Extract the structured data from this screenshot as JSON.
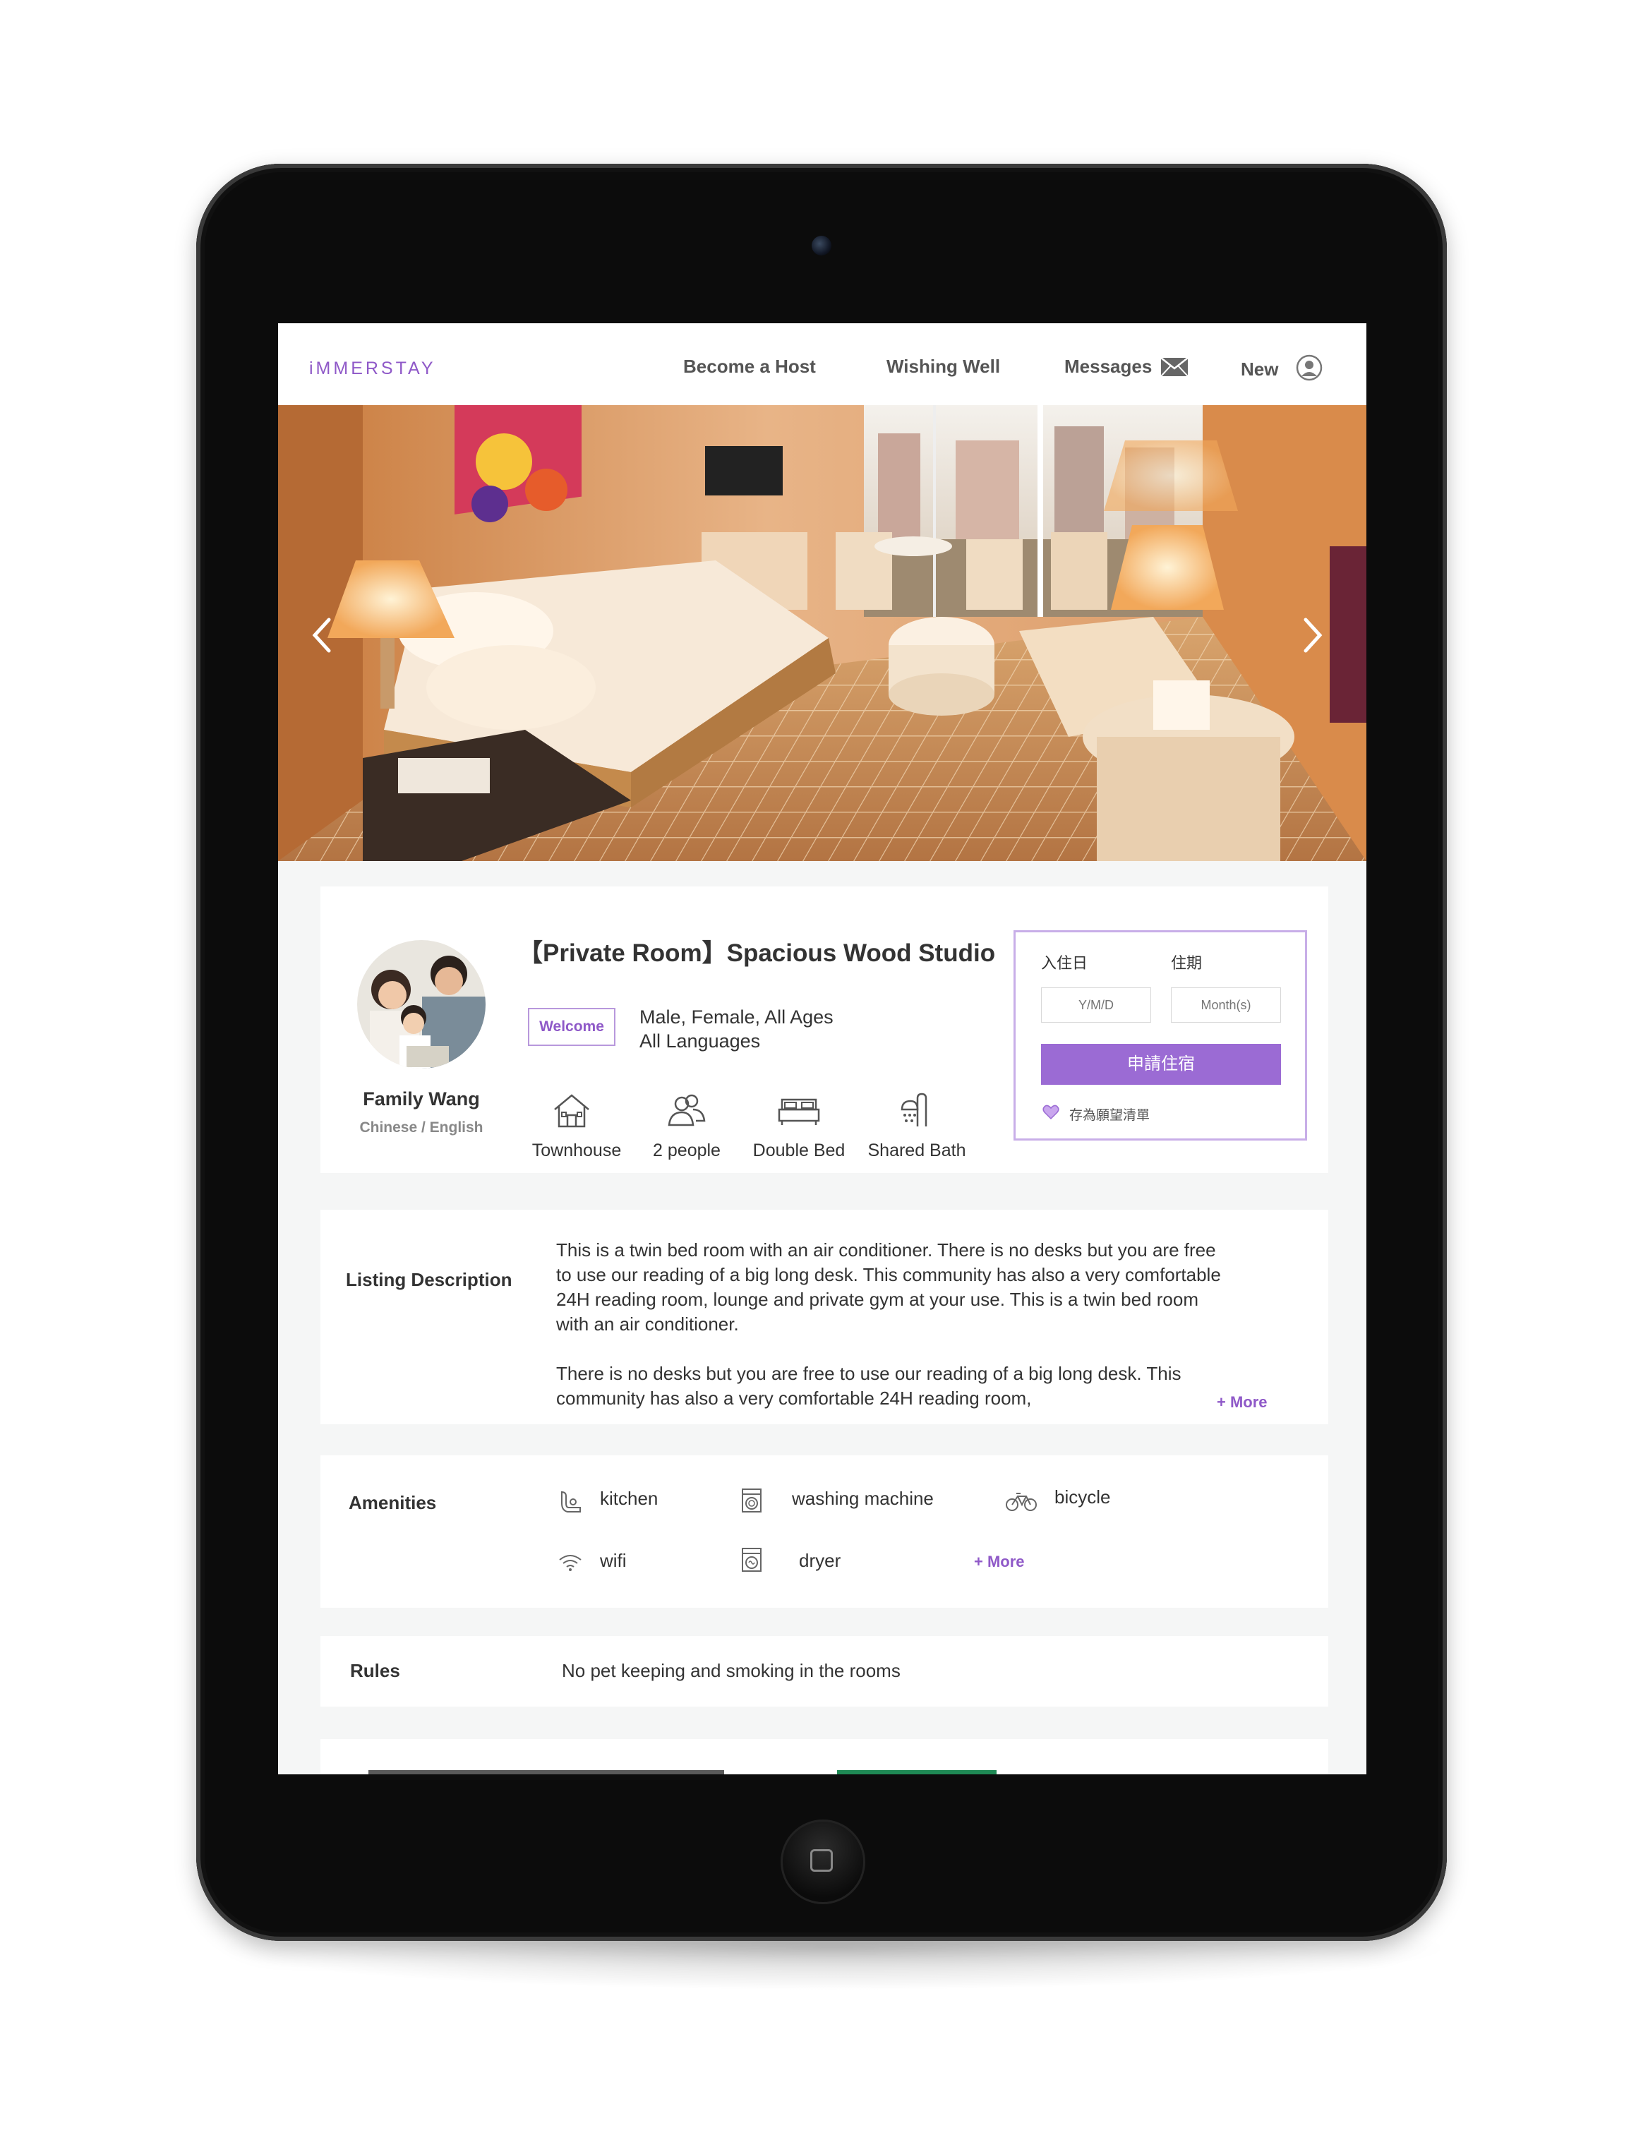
{
  "nav": {
    "logo": "iMMERSTAY",
    "become_host": "Become a Host",
    "wishing_well": "Wishing Well",
    "messages": "Messages",
    "user": "New"
  },
  "hero": {
    "icons": [
      "chevron-left-icon",
      "chevron-right-icon"
    ]
  },
  "host": {
    "name": "Family Wang",
    "languages": "Chinese / English"
  },
  "listing": {
    "title": "【Private Room】Spacious Wood Studio",
    "welcome_badge": "Welcome",
    "guests_line1": "Male, Female, All Ages",
    "guests_line2": "All Languages",
    "features": [
      {
        "icon": "house-icon",
        "label": "Townhouse"
      },
      {
        "icon": "people-icon",
        "label": "2 people"
      },
      {
        "icon": "bed-icon",
        "label": "Double Bed"
      },
      {
        "icon": "shower-icon",
        "label": "Shared Bath"
      }
    ]
  },
  "booking": {
    "checkin_label": "入住日",
    "duration_label": "住期",
    "checkin_placeholder": "Y/M/D",
    "duration_placeholder": "Month(s)",
    "apply_button": "申請住宿",
    "wishlist": "存為願望清單",
    "accent": "#9b6bd4"
  },
  "description": {
    "heading": "Listing Description",
    "para1_lines": [
      "This is a twin bed room with an air conditioner. There is no desks but you are free",
      "to use our reading of a big long desk. This community has also a very comfortable",
      "24H reading room, lounge and private gym at your use. This is a twin bed room",
      "with an air conditioner."
    ],
    "para2_lines": [
      "There is no desks but you are free to use our reading of a big long desk. This",
      "community has also a very comfortable 24H reading room,"
    ],
    "more": "+ More"
  },
  "amenities": {
    "heading": "Amenities",
    "items": [
      {
        "icon": "kitchen-icon",
        "label": "kitchen"
      },
      {
        "icon": "washing-machine-icon",
        "label": "washing machine"
      },
      {
        "icon": "bicycle-icon",
        "label": "bicycle"
      },
      {
        "icon": "wifi-icon",
        "label": "wifi"
      },
      {
        "icon": "dryer-icon",
        "label": "dryer"
      }
    ],
    "more": "+ More"
  },
  "rules": {
    "heading": "Rules",
    "text": "No pet keeping and smoking in the rooms"
  }
}
